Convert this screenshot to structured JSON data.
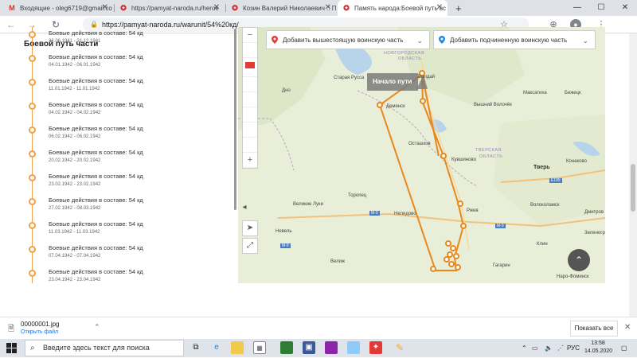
{
  "browser": {
    "tabs": [
      {
        "title": "Входящие - oleg6719@gmail.co",
        "icon": "gmail-icon"
      },
      {
        "title": "https://pamyat-naroda.ru/heroe",
        "icon": "star-icon"
      },
      {
        "title": "Козин Валерий Николаевич :: П",
        "icon": "star-icon"
      },
      {
        "title": "Память народа:Боевой путь вс",
        "icon": "star-icon"
      }
    ],
    "new_tab": "+",
    "url": "https://pamyat-naroda.ru/warunit/54%20кд/"
  },
  "section_title": "Боевой путь части",
  "timeline": [
    {
      "label": "Боевые действия в составе: 54 кд",
      "dates": "22.06.1941 - 31.12.1941"
    },
    {
      "label": "Боевые действия в составе: 54 кд",
      "dates": "04.01.1942 - 06.01.1942"
    },
    {
      "label": "Боевые действия в составе: 54 кд",
      "dates": "11.01.1942 - 11.01.1942"
    },
    {
      "label": "Боевые действия в составе: 54 кд",
      "dates": "04.02.1942 - 04.02.1942"
    },
    {
      "label": "Боевые действия в составе: 54 кд",
      "dates": "06.02.1942 - 06.02.1942"
    },
    {
      "label": "Боевые действия в составе: 54 кд",
      "dates": "20.02.1942 - 20.02.1942"
    },
    {
      "label": "Боевые действия в составе: 54 кд",
      "dates": "23.02.1942 - 23.02.1942"
    },
    {
      "label": "Боевые действия в составе: 54 кд",
      "dates": "27.02.1942 - 08.03.1942"
    },
    {
      "label": "Боевые действия в составе: 54 кд",
      "dates": "11.03.1942 - 11.03.1942"
    },
    {
      "label": "Боевые действия в составе: 54 кд",
      "dates": "07.04.1942 - 07.04.1942"
    },
    {
      "label": "Боевые действия в составе: 54 кд",
      "dates": "23.04.1942 - 23.04.1942"
    }
  ],
  "map": {
    "add_higher_unit": "Добавить вышестоящую воинскую часть",
    "add_subordinate_unit": "Добавить подчиненную воинскую часть",
    "start_label": "Начало пути",
    "places": [
      {
        "name": "НОВГОРОДСКАЯ",
        "cls": "region"
      },
      {
        "name": "ОБЛАСТЬ",
        "cls": "region"
      },
      {
        "name": "ТВЕРСКАЯ",
        "cls": "region"
      },
      {
        "name": "ОБЛАСТЬ",
        "cls": "region"
      },
      {
        "name": "Старая Русса",
        "cls": "city"
      },
      {
        "name": "Демянск",
        "cls": "city"
      },
      {
        "name": "Валдай",
        "cls": "city"
      },
      {
        "name": "Дно",
        "cls": "city"
      },
      {
        "name": "Осташков",
        "cls": "city"
      },
      {
        "name": "Кувшиново",
        "cls": "city"
      },
      {
        "name": "Максатиха",
        "cls": "city"
      },
      {
        "name": "Бежецк",
        "cls": "city"
      },
      {
        "name": "Вышний Волочёк",
        "cls": "city"
      },
      {
        "name": "Тверь",
        "cls": "bigcity"
      },
      {
        "name": "Торопец",
        "cls": "city"
      },
      {
        "name": "Великие Луки",
        "cls": "city"
      },
      {
        "name": "Нелидово",
        "cls": "city"
      },
      {
        "name": "Ржев",
        "cls": "city"
      },
      {
        "name": "Волоколамск",
        "cls": "city"
      },
      {
        "name": "Клин",
        "cls": "city"
      },
      {
        "name": "Дмитров",
        "cls": "city"
      },
      {
        "name": "Зеленоград",
        "cls": "city"
      },
      {
        "name": "Невель",
        "cls": "city"
      },
      {
        "name": "Велиж",
        "cls": "city"
      },
      {
        "name": "Гагарин",
        "cls": "city"
      },
      {
        "name": "Наро-Фоминск",
        "cls": "city"
      },
      {
        "name": "Конаково",
        "cls": "city"
      },
      {
        "name": "М-9",
        "cls": "road"
      },
      {
        "name": "М-9",
        "cls": "road"
      },
      {
        "name": "М-9",
        "cls": "road"
      },
      {
        "name": "Е105",
        "cls": "road"
      }
    ]
  },
  "download": {
    "filename": "00000001.jpg",
    "open": "Открыть файл",
    "show_all": "Показать все"
  },
  "taskbar": {
    "search_placeholder": "Введите здесь текст для поиска",
    "lang": "РУС",
    "time": "13:58",
    "date": "14.05.2020"
  }
}
